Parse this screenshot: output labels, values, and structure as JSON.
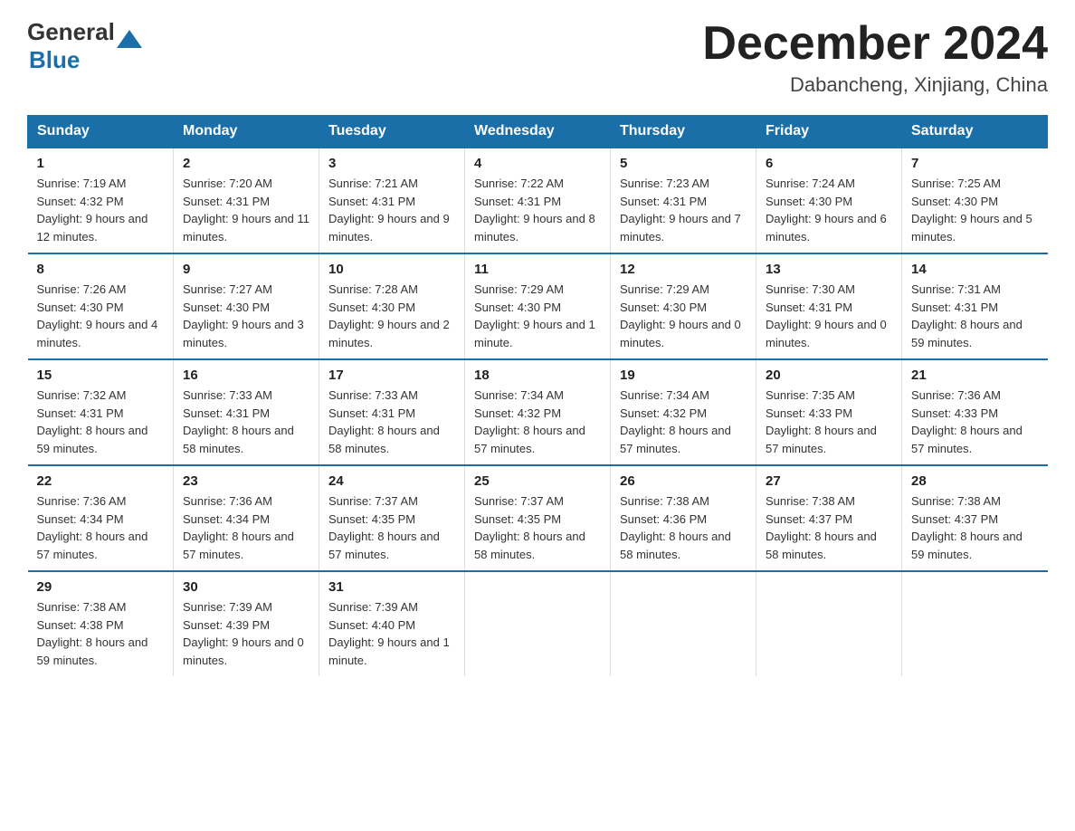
{
  "header": {
    "logo_general": "General",
    "logo_blue": "Blue",
    "month_title": "December 2024",
    "location": "Dabancheng, Xinjiang, China"
  },
  "weekdays": [
    "Sunday",
    "Monday",
    "Tuesday",
    "Wednesday",
    "Thursday",
    "Friday",
    "Saturday"
  ],
  "weeks": [
    [
      {
        "day": "1",
        "sunrise": "7:19 AM",
        "sunset": "4:32 PM",
        "daylight": "9 hours and 12 minutes."
      },
      {
        "day": "2",
        "sunrise": "7:20 AM",
        "sunset": "4:31 PM",
        "daylight": "9 hours and 11 minutes."
      },
      {
        "day": "3",
        "sunrise": "7:21 AM",
        "sunset": "4:31 PM",
        "daylight": "9 hours and 9 minutes."
      },
      {
        "day": "4",
        "sunrise": "7:22 AM",
        "sunset": "4:31 PM",
        "daylight": "9 hours and 8 minutes."
      },
      {
        "day": "5",
        "sunrise": "7:23 AM",
        "sunset": "4:31 PM",
        "daylight": "9 hours and 7 minutes."
      },
      {
        "day": "6",
        "sunrise": "7:24 AM",
        "sunset": "4:30 PM",
        "daylight": "9 hours and 6 minutes."
      },
      {
        "day": "7",
        "sunrise": "7:25 AM",
        "sunset": "4:30 PM",
        "daylight": "9 hours and 5 minutes."
      }
    ],
    [
      {
        "day": "8",
        "sunrise": "7:26 AM",
        "sunset": "4:30 PM",
        "daylight": "9 hours and 4 minutes."
      },
      {
        "day": "9",
        "sunrise": "7:27 AM",
        "sunset": "4:30 PM",
        "daylight": "9 hours and 3 minutes."
      },
      {
        "day": "10",
        "sunrise": "7:28 AM",
        "sunset": "4:30 PM",
        "daylight": "9 hours and 2 minutes."
      },
      {
        "day": "11",
        "sunrise": "7:29 AM",
        "sunset": "4:30 PM",
        "daylight": "9 hours and 1 minute."
      },
      {
        "day": "12",
        "sunrise": "7:29 AM",
        "sunset": "4:30 PM",
        "daylight": "9 hours and 0 minutes."
      },
      {
        "day": "13",
        "sunrise": "7:30 AM",
        "sunset": "4:31 PM",
        "daylight": "9 hours and 0 minutes."
      },
      {
        "day": "14",
        "sunrise": "7:31 AM",
        "sunset": "4:31 PM",
        "daylight": "8 hours and 59 minutes."
      }
    ],
    [
      {
        "day": "15",
        "sunrise": "7:32 AM",
        "sunset": "4:31 PM",
        "daylight": "8 hours and 59 minutes."
      },
      {
        "day": "16",
        "sunrise": "7:33 AM",
        "sunset": "4:31 PM",
        "daylight": "8 hours and 58 minutes."
      },
      {
        "day": "17",
        "sunrise": "7:33 AM",
        "sunset": "4:31 PM",
        "daylight": "8 hours and 58 minutes."
      },
      {
        "day": "18",
        "sunrise": "7:34 AM",
        "sunset": "4:32 PM",
        "daylight": "8 hours and 57 minutes."
      },
      {
        "day": "19",
        "sunrise": "7:34 AM",
        "sunset": "4:32 PM",
        "daylight": "8 hours and 57 minutes."
      },
      {
        "day": "20",
        "sunrise": "7:35 AM",
        "sunset": "4:33 PM",
        "daylight": "8 hours and 57 minutes."
      },
      {
        "day": "21",
        "sunrise": "7:36 AM",
        "sunset": "4:33 PM",
        "daylight": "8 hours and 57 minutes."
      }
    ],
    [
      {
        "day": "22",
        "sunrise": "7:36 AM",
        "sunset": "4:34 PM",
        "daylight": "8 hours and 57 minutes."
      },
      {
        "day": "23",
        "sunrise": "7:36 AM",
        "sunset": "4:34 PM",
        "daylight": "8 hours and 57 minutes."
      },
      {
        "day": "24",
        "sunrise": "7:37 AM",
        "sunset": "4:35 PM",
        "daylight": "8 hours and 57 minutes."
      },
      {
        "day": "25",
        "sunrise": "7:37 AM",
        "sunset": "4:35 PM",
        "daylight": "8 hours and 58 minutes."
      },
      {
        "day": "26",
        "sunrise": "7:38 AM",
        "sunset": "4:36 PM",
        "daylight": "8 hours and 58 minutes."
      },
      {
        "day": "27",
        "sunrise": "7:38 AM",
        "sunset": "4:37 PM",
        "daylight": "8 hours and 58 minutes."
      },
      {
        "day": "28",
        "sunrise": "7:38 AM",
        "sunset": "4:37 PM",
        "daylight": "8 hours and 59 minutes."
      }
    ],
    [
      {
        "day": "29",
        "sunrise": "7:38 AM",
        "sunset": "4:38 PM",
        "daylight": "8 hours and 59 minutes."
      },
      {
        "day": "30",
        "sunrise": "7:39 AM",
        "sunset": "4:39 PM",
        "daylight": "9 hours and 0 minutes."
      },
      {
        "day": "31",
        "sunrise": "7:39 AM",
        "sunset": "4:40 PM",
        "daylight": "9 hours and 1 minute."
      },
      null,
      null,
      null,
      null
    ]
  ]
}
